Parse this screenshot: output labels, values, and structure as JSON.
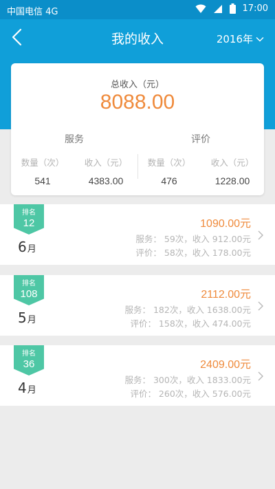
{
  "status_bar": {
    "carrier": "中国电信 4G",
    "time": "17:00"
  },
  "header": {
    "title": "我的收入",
    "year": "2016年"
  },
  "summary": {
    "total_label": "总收入（元）",
    "total_value": "8088.00",
    "service": {
      "title": "服务",
      "count_label": "数量（次）",
      "income_label": "收入（元）",
      "count": "541",
      "income": "4383.00"
    },
    "review": {
      "title": "评价",
      "count_label": "数量（次）",
      "income_label": "收入（元）",
      "count": "476",
      "income": "1228.00"
    }
  },
  "months": [
    {
      "rank_label": "排名",
      "rank": "12",
      "month": "6",
      "month_unit": "月",
      "amount": "1090.00元",
      "service_line": "服务：  59次，收入 912.00元",
      "review_line": "评价：  58次，收入 178.00元"
    },
    {
      "rank_label": "排名",
      "rank": "108",
      "month": "5",
      "month_unit": "月",
      "amount": "2112.00元",
      "service_line": "服务：  182次，收入 1638.00元",
      "review_line": "评价：  158次，收入 474.00元"
    },
    {
      "rank_label": "排名",
      "rank": "36",
      "month": "4",
      "month_unit": "月",
      "amount": "2409.00元",
      "service_line": "服务：  300次，收入 1833.00元",
      "review_line": "评价：  260次，收入 576.00元"
    }
  ],
  "colors": {
    "header": "#109fd9",
    "status_bar": "#0b8ec9",
    "accent_orange": "#ef8a3b",
    "badge_green": "#4ec7a5"
  }
}
